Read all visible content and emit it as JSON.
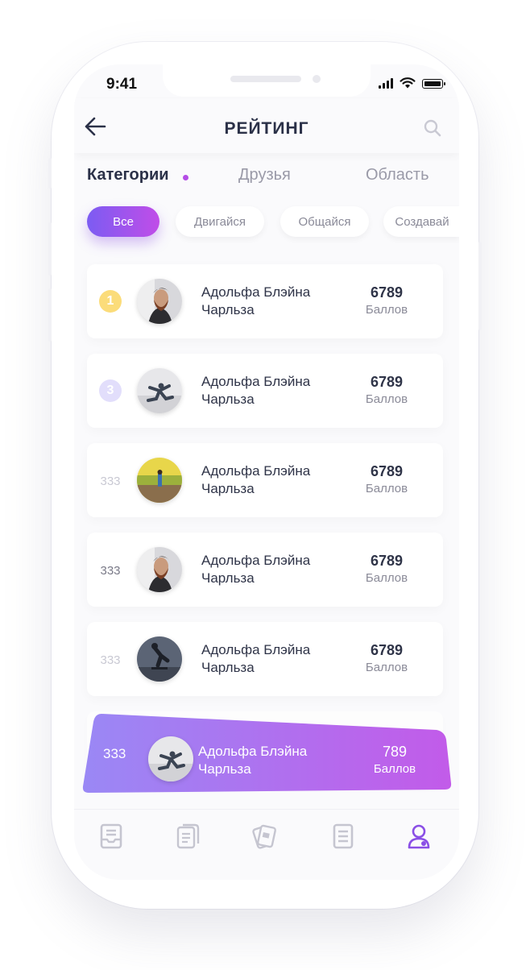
{
  "status_bar": {
    "time": "9:41"
  },
  "header": {
    "title": "РЕЙТИНГ"
  },
  "tabs": [
    {
      "label": "Категории",
      "active": true
    },
    {
      "label": "Друзья",
      "active": false
    },
    {
      "label": "Область",
      "active": false
    }
  ],
  "chips": [
    {
      "label": "Все",
      "active": true
    },
    {
      "label": "Двигайся",
      "active": false
    },
    {
      "label": "Общайся",
      "active": false
    },
    {
      "label": "Создавай",
      "active": false
    }
  ],
  "entries": [
    {
      "rank": "1",
      "rank_style": "badge-gold",
      "name": "Адольфа Блэйна Чарльза",
      "score": "6789",
      "score_label": "Баллов",
      "avatar": "bearded-man"
    },
    {
      "rank": "3",
      "rank_style": "badge-violet",
      "name": "Адольфа Блэйна Чарльза",
      "score": "6789",
      "score_label": "Баллов",
      "avatar": "jumping-man"
    },
    {
      "rank": "333",
      "rank_style": "plain-light",
      "name": "Адольфа Блэйна Чарльза",
      "score": "6789",
      "score_label": "Баллов",
      "avatar": "field-person"
    },
    {
      "rank": "333",
      "rank_style": "plain-dark",
      "name": "Адольфа Блэйна Чарльза",
      "score": "6789",
      "score_label": "Баллов",
      "avatar": "bearded-man"
    },
    {
      "rank": "333",
      "rank_style": "plain-light",
      "name": "Адольфа Блэйна Чарльза",
      "score": "6789",
      "score_label": "Баллов",
      "avatar": "skater"
    }
  ],
  "current_user": {
    "rank": "333",
    "name": "Адольфа Блэйна Чарльза",
    "score": "789",
    "score_label": "Баллов",
    "avatar": "jumping-man"
  },
  "bottom_nav": [
    {
      "icon": "inbox-icon",
      "active": false
    },
    {
      "icon": "documents-icon",
      "active": false
    },
    {
      "icon": "cards-icon",
      "active": false
    },
    {
      "icon": "list-icon",
      "active": false
    },
    {
      "icon": "profile-icon",
      "active": true
    }
  ],
  "colors": {
    "accent_start": "#7c5cf2",
    "accent_end": "#c04de8",
    "text_dark": "#2b3148",
    "text_muted": "#9a9aa8"
  }
}
